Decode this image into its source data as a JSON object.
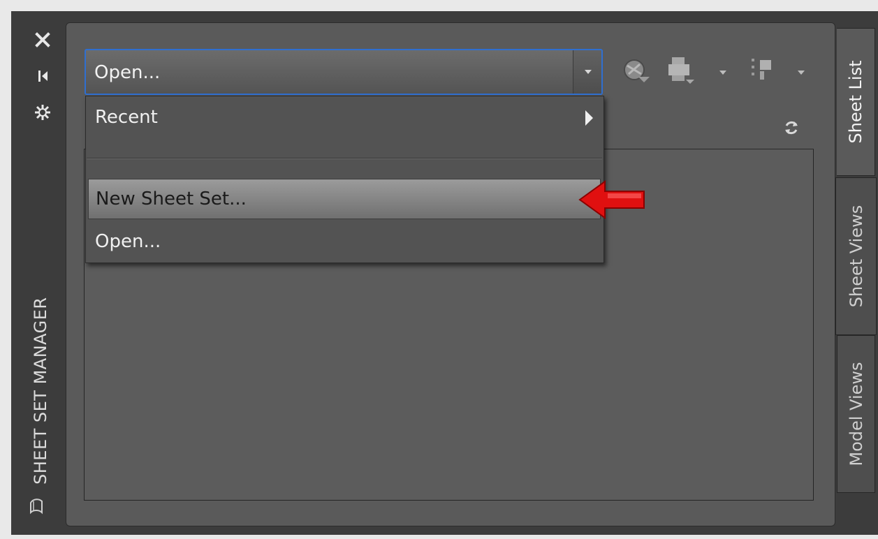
{
  "palette": {
    "title": "SHEET SET MANAGER"
  },
  "titlebar": {
    "icons": [
      "close-icon",
      "auto-hide-icon",
      "properties-icon",
      "sheet-set-icon"
    ]
  },
  "combo": {
    "value": "Open..."
  },
  "toolbar": {
    "icons": [
      "publish-icon",
      "plot-icon",
      "sheet-selections-icon"
    ]
  },
  "menu": {
    "items": [
      {
        "label": "Recent",
        "has_submenu": true
      },
      {
        "label": "New Sheet Set...",
        "highlighted": true
      },
      {
        "label": "Open..."
      }
    ]
  },
  "tabs": [
    {
      "label": "Sheet List",
      "active": true
    },
    {
      "label": "Sheet Views",
      "active": false
    },
    {
      "label": "Model Views",
      "active": false
    }
  ],
  "colors": {
    "accent": "#2f6fd0",
    "annotation_arrow": "#e01010",
    "panel": "#5a5a5a",
    "frame": "#3c3c3c"
  }
}
